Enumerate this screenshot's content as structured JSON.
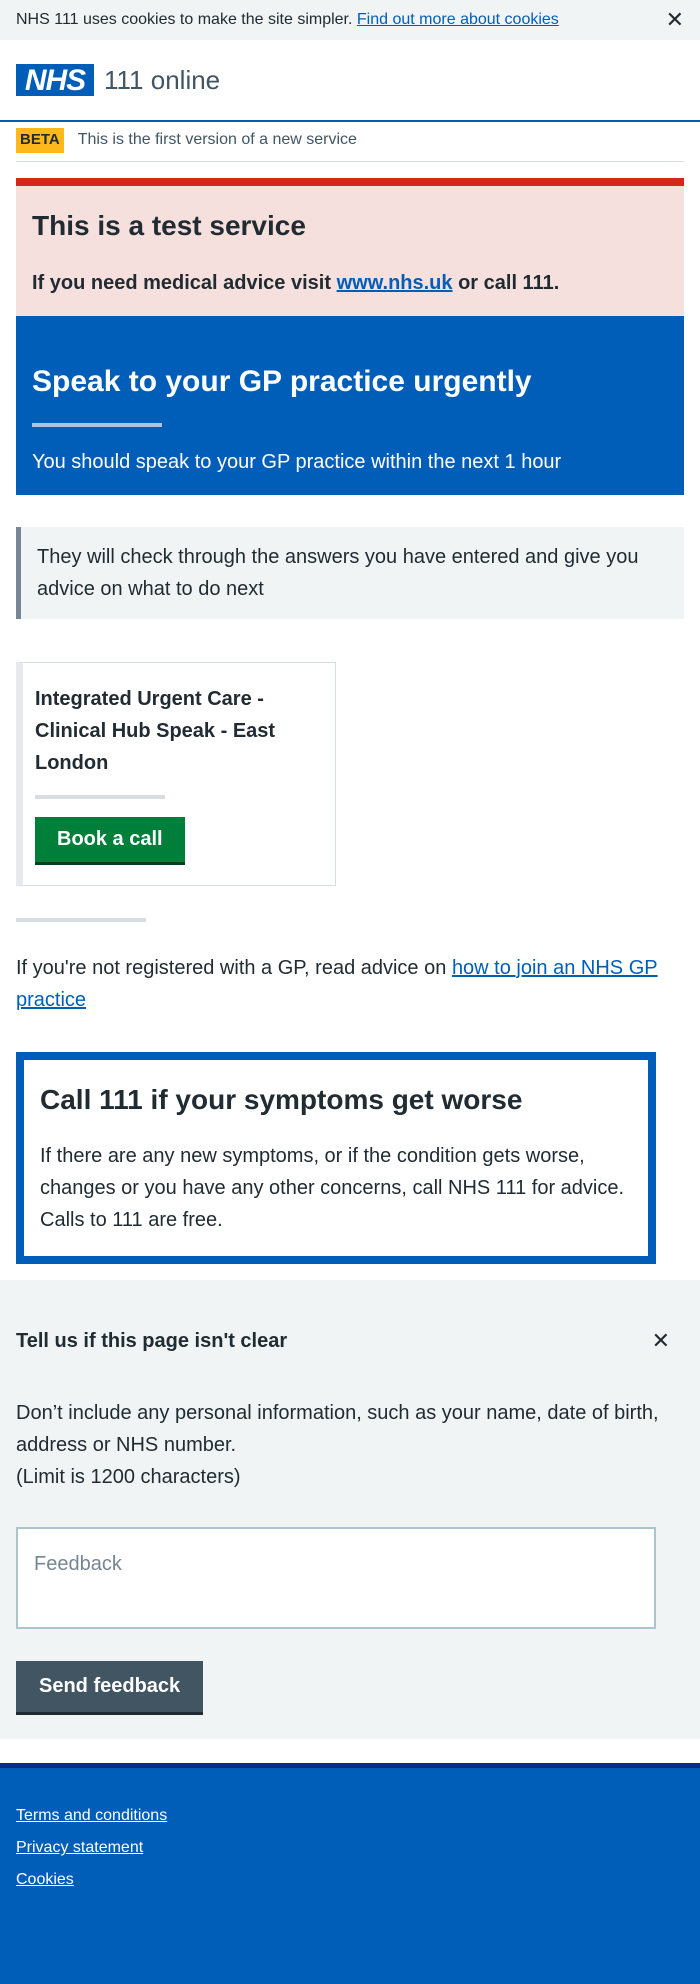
{
  "cookie_banner": {
    "text": "NHS 111 uses cookies to make the site simpler.",
    "link": "Find out more about cookies",
    "close": "✕"
  },
  "header": {
    "logo": "NHS",
    "service": "111 online"
  },
  "beta": {
    "tag": "BETA",
    "text": "This is the first version of a new service"
  },
  "test_service": {
    "title": "This is a test service",
    "prefix": "If you need medical advice visit",
    "link": "www.nhs.uk",
    "suffix": "or call 111."
  },
  "result": {
    "title": "Speak to your GP practice urgently",
    "subtitle": "You should speak to your GP practice within the next 1 hour"
  },
  "inset": {
    "text": "They will check through the answers you have entered and give you advice on what to do next"
  },
  "service_card": {
    "title": "Integrated Urgent Care - Clinical Hub Speak - East London",
    "button": "Book a call"
  },
  "gp_info": {
    "text": "If you're not registered with a GP, read advice on",
    "link": "how to join an NHS GP practice"
  },
  "care_card": {
    "title": "Call 111 if your symptoms get worse",
    "text": "If there are any new symptoms, or if the condition gets worse, changes or you have any other concerns, call NHS 111 for advice. Calls to 111 are free."
  },
  "feedback": {
    "title": "Tell us if this page isn't clear",
    "close": "✕",
    "hint": "Don’t include any personal information, such as your name, date of birth, address or NHS number.",
    "limit": "(Limit is 1200 characters)",
    "placeholder": "Feedback",
    "button": "Send feedback"
  },
  "footer": {
    "links": [
      "Terms and conditions",
      "Privacy statement",
      "Cookies"
    ]
  }
}
